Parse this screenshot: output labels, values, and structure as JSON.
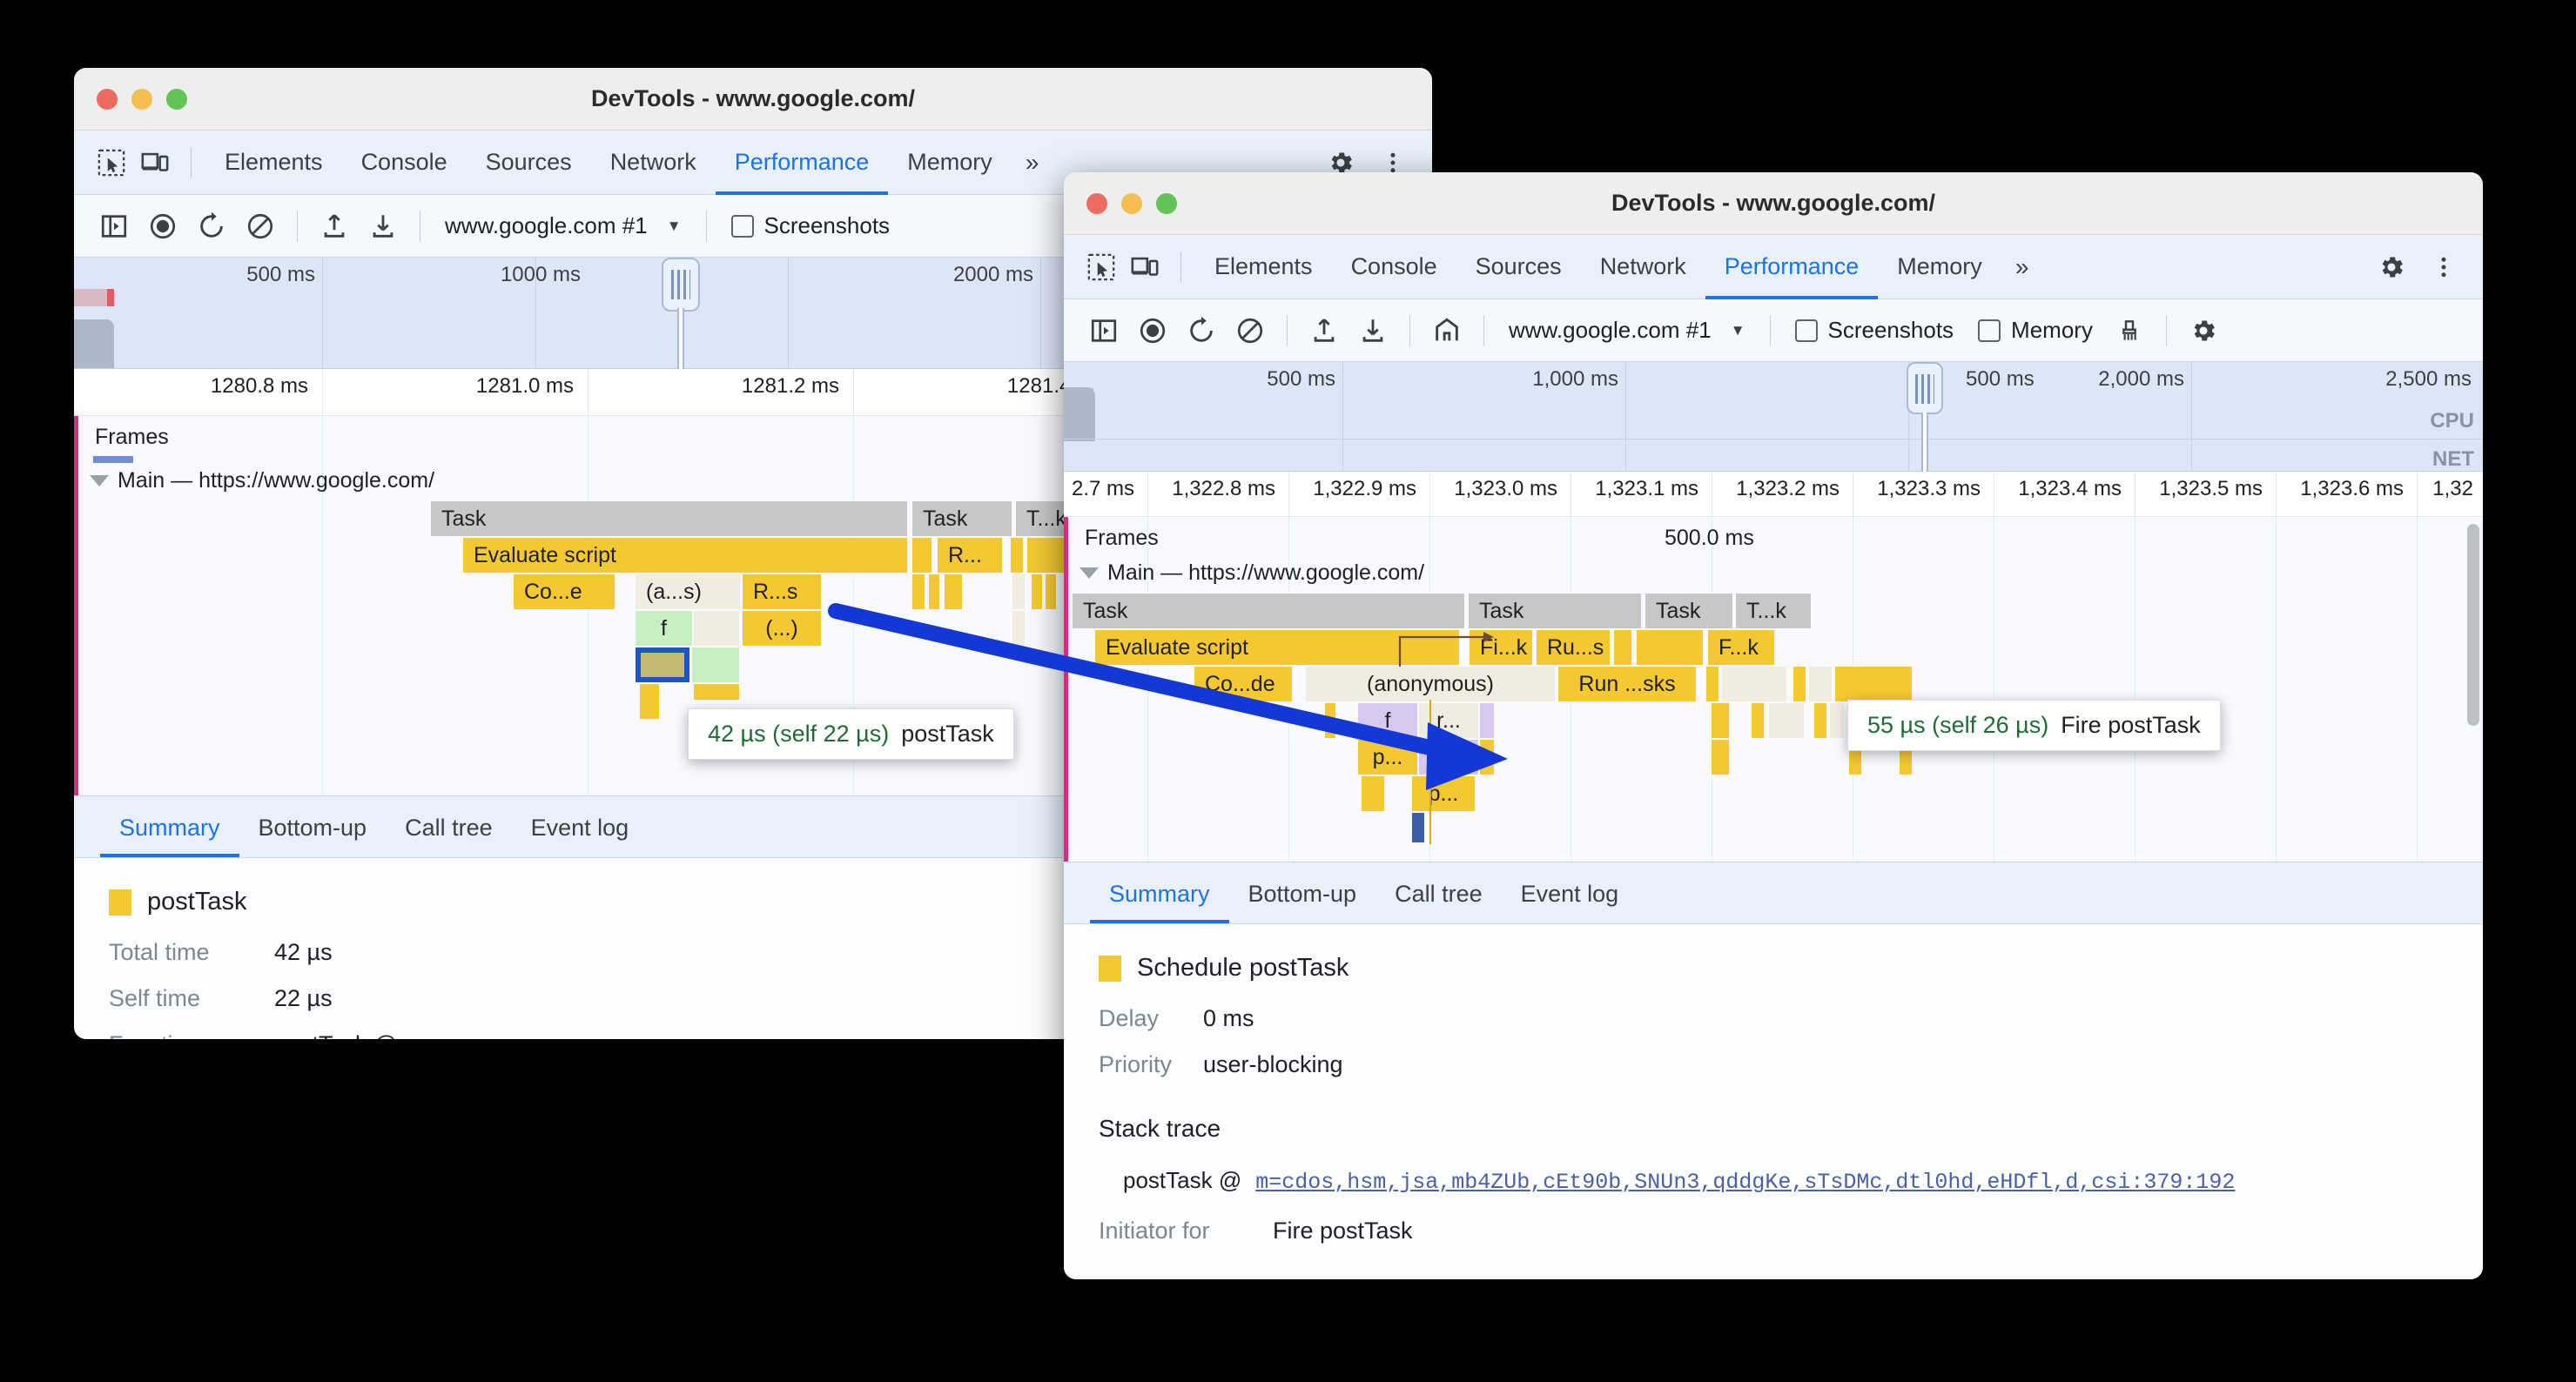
{
  "back_window": {
    "title": "DevTools - www.google.com/",
    "traffic_lights": [
      "close",
      "minimize",
      "zoom"
    ],
    "toolbar_icons": [
      "inspect-icon",
      "device-toggle-icon"
    ],
    "tabs": [
      {
        "label": "Elements",
        "selected": false
      },
      {
        "label": "Console",
        "selected": false
      },
      {
        "label": "Sources",
        "selected": false
      },
      {
        "label": "Network",
        "selected": false
      },
      {
        "label": "Performance",
        "selected": true
      },
      {
        "label": "Memory",
        "selected": false
      }
    ],
    "more_tabs": "»",
    "settings_icon": "gear-icon",
    "menu_icon": "kebab-menu-icon",
    "controls": {
      "sidebar_label": "show-sidebar-icon",
      "record_label": "record-icon",
      "reload_label": "reload-record-icon",
      "clear_label": "clear-icon",
      "upload_label": "upload-icon",
      "download_label": "download-icon",
      "url_value": "www.google.com #1",
      "dropdown_caret": "▼",
      "screenshots_label": "Screenshots"
    },
    "overview": {
      "ticks": [
        "500 ms",
        "1000 ms",
        "2000 ms"
      ]
    },
    "ruler": {
      "ticks": [
        "1280.8 ms",
        "1281.0 ms",
        "1281.2 ms",
        "1281.4 ms"
      ]
    },
    "frames_label": "Frames",
    "main_track_label": "Main — https://www.google.com/",
    "flame_bars": [
      {
        "label": "Task",
        "kind": "task"
      },
      {
        "label": "Task",
        "kind": "task"
      },
      {
        "label": "T...k",
        "kind": "task"
      },
      {
        "label": "Evaluate script",
        "kind": "yellow"
      },
      {
        "label": "R...",
        "kind": "yellow"
      },
      {
        "label": "Co...e",
        "kind": "yellow"
      },
      {
        "label": "(a...s)",
        "kind": "cream"
      },
      {
        "label": "R...s",
        "kind": "yellow"
      },
      {
        "label": "f",
        "kind": "green"
      },
      {
        "label": "(...)",
        "kind": "yellow"
      }
    ],
    "tooltip": {
      "duration": "42 µs (self 22 µs)",
      "name": "postTask"
    },
    "bottom_tabs": [
      {
        "label": "Summary",
        "selected": true
      },
      {
        "label": "Bottom-up",
        "selected": false
      },
      {
        "label": "Call tree",
        "selected": false
      },
      {
        "label": "Event log",
        "selected": false
      }
    ],
    "summary": {
      "event_name": "postTask",
      "swatch_color": "#f3c830",
      "rows": [
        {
          "key": "Total time",
          "value": "42 µs"
        },
        {
          "key": "Self time",
          "value": "22 µs"
        },
        {
          "key": "Function",
          "value": "postTask @"
        }
      ]
    }
  },
  "front_window": {
    "title": "DevTools - www.google.com/",
    "tabs": [
      {
        "label": "Elements",
        "selected": false
      },
      {
        "label": "Console",
        "selected": false
      },
      {
        "label": "Sources",
        "selected": false
      },
      {
        "label": "Network",
        "selected": false
      },
      {
        "label": "Performance",
        "selected": true
      },
      {
        "label": "Memory",
        "selected": false
      }
    ],
    "more_tabs": "»",
    "settings_icon": "gear-icon",
    "menu_icon": "kebab-menu-icon",
    "controls": {
      "url_value": "www.google.com #1",
      "dropdown_caret": "▼",
      "screenshots_label": "Screenshots",
      "memory_label": "Memory",
      "brush_label": "clear-brush-icon",
      "gear_label": "gear-icon"
    },
    "overview": {
      "ticks": [
        "500 ms",
        "1,000 ms",
        "500 ms",
        "2,000 ms",
        "2,500 ms"
      ],
      "cpu_label": "CPU",
      "net_label": "NET"
    },
    "ruler": {
      "ticks": [
        "2.7 ms",
        "1,322.8 ms",
        "1,322.9 ms",
        "1,323.0 ms",
        "1,323.1 ms",
        "1,323.2 ms",
        "1,323.3 ms",
        "1,323.4 ms",
        "1,323.5 ms",
        "1,323.6 ms",
        "1,32"
      ]
    },
    "frames_label": "Frames",
    "frame_duration": "500.0 ms",
    "main_track_label": "Main — https://www.google.com/",
    "flame_bars": [
      {
        "label": "Task",
        "kind": "task"
      },
      {
        "label": "Task",
        "kind": "task"
      },
      {
        "label": "Task",
        "kind": "task"
      },
      {
        "label": "T...k",
        "kind": "task"
      },
      {
        "label": "Evaluate script",
        "kind": "yellow"
      },
      {
        "label": "Fi...k",
        "kind": "yellow"
      },
      {
        "label": "Ru...s",
        "kind": "yellow"
      },
      {
        "label": "F...k",
        "kind": "yellow"
      },
      {
        "label": "Co...de",
        "kind": "yellow"
      },
      {
        "label": "(anonymous)",
        "kind": "cream"
      },
      {
        "label": "Run ...sks",
        "kind": "yellow"
      },
      {
        "label": "f",
        "kind": "purple"
      },
      {
        "label": "r...",
        "kind": "cream"
      },
      {
        "label": "p...",
        "kind": "yellow"
      },
      {
        "label": "f",
        "kind": "purple"
      },
      {
        "label": "p...",
        "kind": "yellow"
      }
    ],
    "tooltip": {
      "duration": "55 µs (self 26 µs)",
      "name": "Fire postTask"
    },
    "bottom_tabs": [
      {
        "label": "Summary",
        "selected": true
      },
      {
        "label": "Bottom-up",
        "selected": false
      },
      {
        "label": "Call tree",
        "selected": false
      },
      {
        "label": "Event log",
        "selected": false
      }
    ],
    "summary": {
      "event_name": "Schedule postTask",
      "swatch_color": "#f3c830",
      "rows": [
        {
          "key": "Delay",
          "value": "0 ms"
        },
        {
          "key": "Priority",
          "value": "user-blocking"
        }
      ],
      "stack_trace_heading": "Stack trace",
      "stack_function": "postTask @",
      "stack_link": "m=cdos,hsm,jsa,mb4ZUb,cEt90b,SNUn3,qddgKe,sTsDMc,dtl0hd,eHDfl,d,csi:379:192",
      "initiator_key": "Initiator for",
      "initiator_value": "Fire postTask"
    }
  },
  "annotation": {
    "arrow_color": "#1438d8"
  }
}
